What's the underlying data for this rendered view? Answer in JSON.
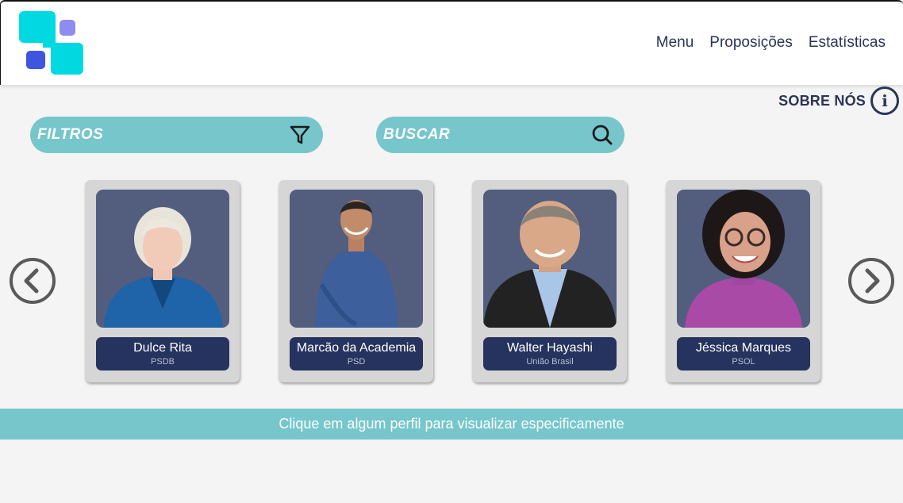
{
  "header": {
    "logo": {
      "name": "app-logo",
      "colors": [
        "#00d9e0",
        "#8e8cef",
        "#3e55e0"
      ]
    },
    "nav": [
      {
        "label": "Menu"
      },
      {
        "label": "Proposições"
      },
      {
        "label": "Estatísticas"
      }
    ]
  },
  "about": {
    "label": "SOBRE NÓS",
    "icon": "info-icon"
  },
  "filters": {
    "label": "FILTROS",
    "icon": "filter-icon"
  },
  "search": {
    "label": "BUSCAR",
    "icon": "search-icon"
  },
  "carousel": {
    "prev_icon": "chevron-left-icon",
    "next_icon": "chevron-right-icon",
    "cards": [
      {
        "name": "Dulce Rita",
        "party": "PSDB"
      },
      {
        "name": "Marcão da Academia",
        "party": "PSD"
      },
      {
        "name": "Walter Hayashi",
        "party": "União Brasil"
      },
      {
        "name": "Jéssica Marques",
        "party": "PSOL"
      }
    ]
  },
  "hint": "Clique em algum perfil para visualizar especificamente",
  "colors": {
    "accent": "#76c6cb",
    "navy": "#25335e",
    "photo_bg": "#535d7e",
    "text_dark": "#2a3558"
  }
}
